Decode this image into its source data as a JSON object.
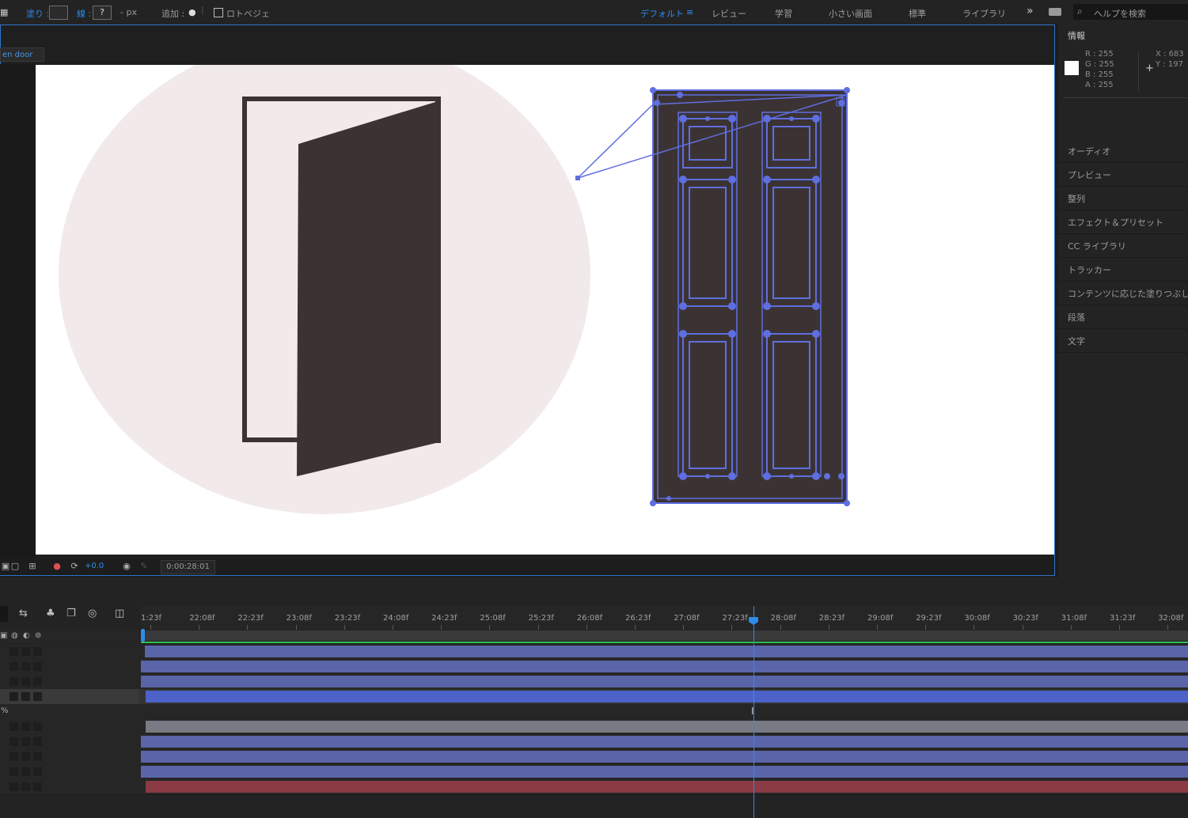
{
  "toolbar": {
    "fill_label": "塗り :",
    "stroke_label": "線 :",
    "stroke_value": "?",
    "px_label": "- px",
    "add_label": "追加 :",
    "bezier_label": "ロトベジェ"
  },
  "workspaces": {
    "items": [
      "デフォルト",
      "レビュー",
      "学習",
      "小さい画面",
      "標準",
      "ライブラリ"
    ],
    "active": "デフォルト",
    "menu_icon": "≡",
    "more_icon": "»",
    "search_placeholder": "ヘルプを検索"
  },
  "comp": {
    "tab_label": "en door",
    "exposure_value": "+0.0",
    "timecode": "0:00:28:01"
  },
  "info_panel": {
    "title": "情報",
    "r": "R :  255",
    "g": "G :  255",
    "b": "B :  255",
    "a": "A :  255",
    "x": "X :  683",
    "y": "Y :  197"
  },
  "panels": [
    "オーディオ",
    "プレビュー",
    "整列",
    "エフェクト＆プリセット",
    "CC ライブラリ",
    "トラッカー",
    "コンテンツに応じた塗りつぶし",
    "段落",
    "文字"
  ],
  "timeline": {
    "ticks": [
      "1:23f",
      "22:08f",
      "22:23f",
      "23:08f",
      "23:23f",
      "24:08f",
      "24:23f",
      "25:08f",
      "25:23f",
      "26:08f",
      "26:23f",
      "27:08f",
      "27:23f",
      "28:08f",
      "28:23f",
      "29:08f",
      "29:23f",
      "30:08f",
      "30:23f",
      "31:08f",
      "31:23f",
      "32:08f"
    ],
    "percent_label": "%"
  },
  "colors": {
    "accent": "#2d8ceb",
    "door": "#3b3333",
    "circle": "#f2eaea",
    "path": "#5f6ee0",
    "bar_blue": "#5a64a8",
    "bar_red": "#8a3b44",
    "bar_gray": "#7a7a84"
  }
}
